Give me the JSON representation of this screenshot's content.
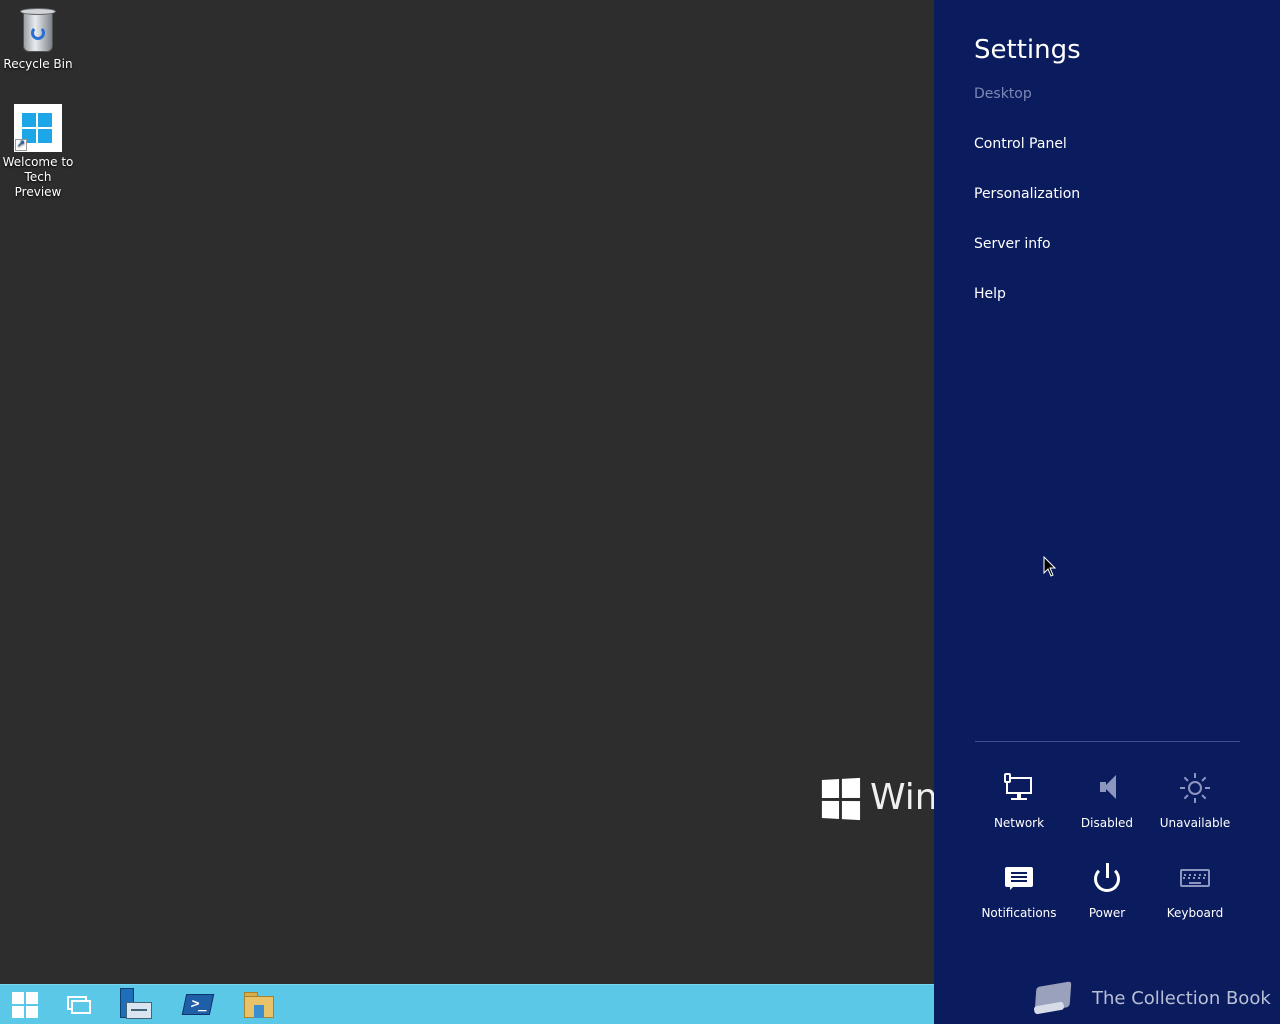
{
  "desktop": {
    "icons": [
      {
        "label": "Recycle Bin",
        "icon": "recycle-bin-icon"
      },
      {
        "label": "Welcome to Tech Preview",
        "icon": "windows-logo-icon"
      }
    ],
    "watermark_text": "Wind"
  },
  "taskbar": {
    "buttons": [
      {
        "name": "start",
        "icon": "windows-logo-icon"
      },
      {
        "name": "task-view",
        "icon": "task-view-icon"
      },
      {
        "name": "server-manager",
        "icon": "server-manager-icon"
      },
      {
        "name": "powershell",
        "icon": "powershell-icon"
      },
      {
        "name": "file-explorer",
        "icon": "folder-icon"
      }
    ],
    "color": "#5bc8e8"
  },
  "charm": {
    "title": "Settings",
    "subtitle": "Desktop",
    "links": [
      "Control Panel",
      "Personalization",
      "Server info",
      "Help"
    ],
    "quick_settings": [
      {
        "label": "Network",
        "icon": "network-icon",
        "enabled": true
      },
      {
        "label": "Disabled",
        "icon": "volume-icon",
        "enabled": false
      },
      {
        "label": "Unavailable",
        "icon": "brightness-icon",
        "enabled": false
      },
      {
        "label": "Notifications",
        "icon": "notifications-icon",
        "enabled": true
      },
      {
        "label": "Power",
        "icon": "power-icon",
        "enabled": true
      },
      {
        "label": "Keyboard",
        "icon": "keyboard-icon",
        "enabled": false
      }
    ],
    "background_color": "#0b1c5e",
    "watermark_label": "The Collection Book"
  }
}
